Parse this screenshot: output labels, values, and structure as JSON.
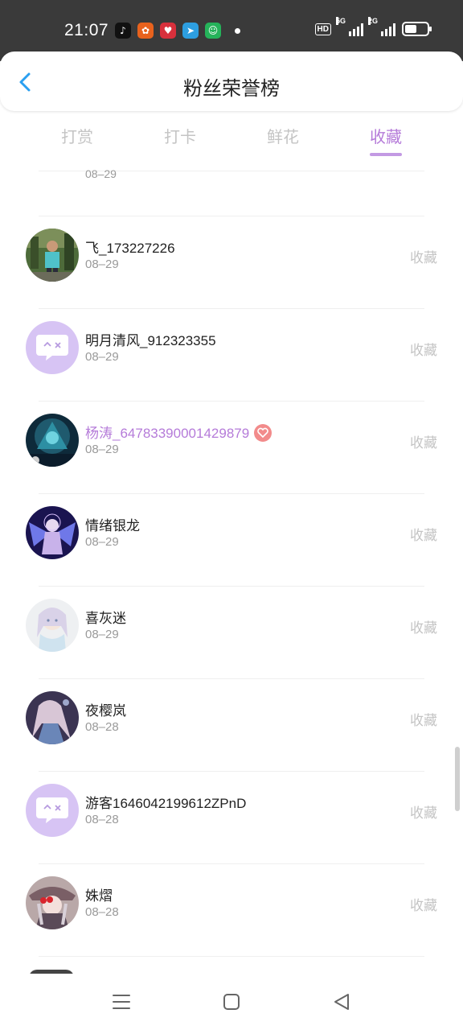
{
  "status_bar": {
    "time": "21:07",
    "app_icons": [
      "tiktok-icon",
      "shopping-app-icon",
      "heart-app-icon",
      "telegram-icon",
      "wechat-app-icon"
    ],
    "network_labels": [
      "HD",
      "5G",
      "2G"
    ],
    "battery_level": 0.55
  },
  "header": {
    "title": "粉丝荣誉榜",
    "back_icon": "chevron-left-icon"
  },
  "tabs": [
    {
      "label": "打赏",
      "active": false
    },
    {
      "label": "打卡",
      "active": false
    },
    {
      "label": "鲜花",
      "active": false
    },
    {
      "label": "收藏",
      "active": true
    }
  ],
  "list": {
    "partial_top_date": "08–29",
    "action_label": "收藏",
    "rows": [
      {
        "name": "飞_173227226",
        "date": "08–29",
        "avatar": "photo",
        "vip": false
      },
      {
        "name": "明月清风_912323355",
        "date": "08–29",
        "avatar": "default",
        "vip": false
      },
      {
        "name": "杨涛_64783390001429879",
        "date": "08–29",
        "avatar": "photo",
        "vip": true
      },
      {
        "name": "情绪银龙",
        "date": "08–29",
        "avatar": "photo",
        "vip": false
      },
      {
        "name": "喜灰迷",
        "date": "08–29",
        "avatar": "photo",
        "vip": false
      },
      {
        "name": "夜樱岚",
        "date": "08–28",
        "avatar": "photo",
        "vip": false
      },
      {
        "name": "游客1646042199612ZPnD",
        "date": "08–28",
        "avatar": "default",
        "vip": false
      },
      {
        "name": "姝熠",
        "date": "08–28",
        "avatar": "photo",
        "vip": false
      }
    ]
  },
  "colors": {
    "accent": "#b57bd9",
    "tab_inactive": "#c4c4c4",
    "default_avatar": "#d7c4f4",
    "vip_badge": "#f28b8b",
    "status_bar": "#3a3a3a"
  },
  "navbar": {
    "icons": [
      "menu-icon",
      "home-square-icon",
      "back-triangle-icon"
    ]
  }
}
